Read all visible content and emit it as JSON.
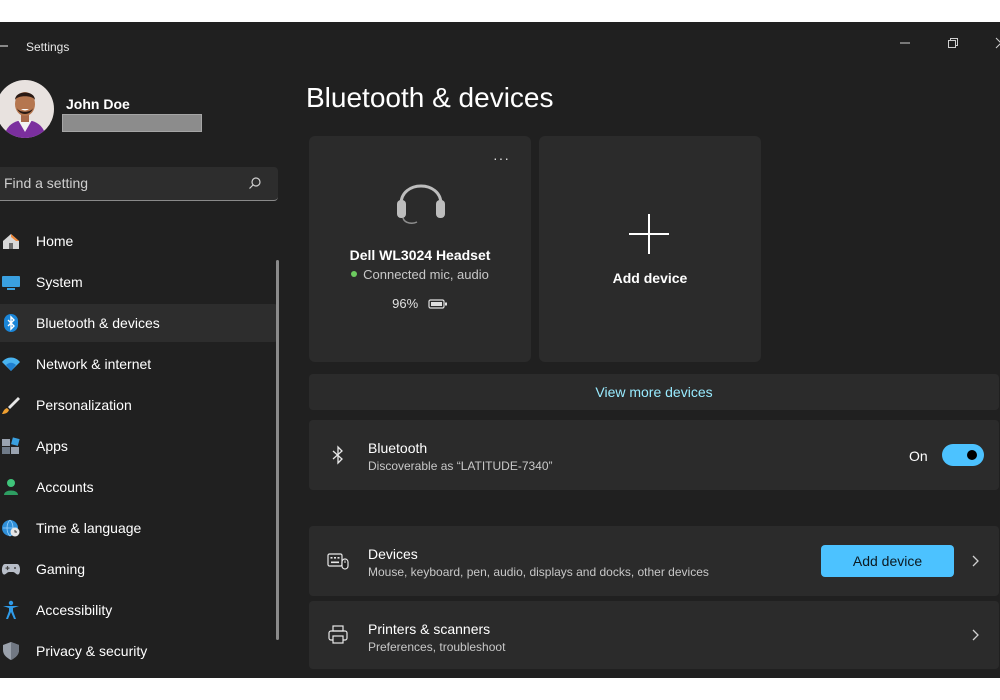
{
  "window": {
    "title": "Settings"
  },
  "profile": {
    "name": "John Doe"
  },
  "search": {
    "placeholder": "Find a setting"
  },
  "sidebar": {
    "items": [
      {
        "label": "Home",
        "icon": "home-icon",
        "selected": false
      },
      {
        "label": "System",
        "icon": "monitor-icon",
        "selected": false
      },
      {
        "label": "Bluetooth & devices",
        "icon": "bluetooth-icon",
        "selected": true
      },
      {
        "label": "Network & internet",
        "icon": "wifi-icon",
        "selected": false
      },
      {
        "label": "Personalization",
        "icon": "brush-icon",
        "selected": false
      },
      {
        "label": "Apps",
        "icon": "apps-icon",
        "selected": false
      },
      {
        "label": "Accounts",
        "icon": "account-icon",
        "selected": false
      },
      {
        "label": "Time & language",
        "icon": "globe-clock-icon",
        "selected": false
      },
      {
        "label": "Gaming",
        "icon": "gamepad-icon",
        "selected": false
      },
      {
        "label": "Accessibility",
        "icon": "accessibility-icon",
        "selected": false
      },
      {
        "label": "Privacy & security",
        "icon": "shield-icon",
        "selected": false
      }
    ]
  },
  "main": {
    "title": "Bluetooth & devices",
    "device_card": {
      "name": "Dell WL3024 Headset",
      "status": "Connected mic, audio",
      "battery": "96%",
      "more_label": "···"
    },
    "add_card": {
      "label": "Add device"
    },
    "view_more": "View more devices",
    "bluetooth": {
      "title": "Bluetooth",
      "subtitle": "Discoverable as “LATITUDE-7340”",
      "state": "On"
    },
    "devices_row": {
      "title": "Devices",
      "subtitle": "Mouse, keyboard, pen, audio, displays and docks, other devices",
      "button": "Add device"
    },
    "printers_row": {
      "title": "Printers & scanners",
      "subtitle": "Preferences, troubleshoot"
    }
  },
  "colors": {
    "background": "#202020",
    "card": "#2b2b2b",
    "accent": "#4cc2ff",
    "link": "#99ebff",
    "connected": "#6ccb5f"
  }
}
